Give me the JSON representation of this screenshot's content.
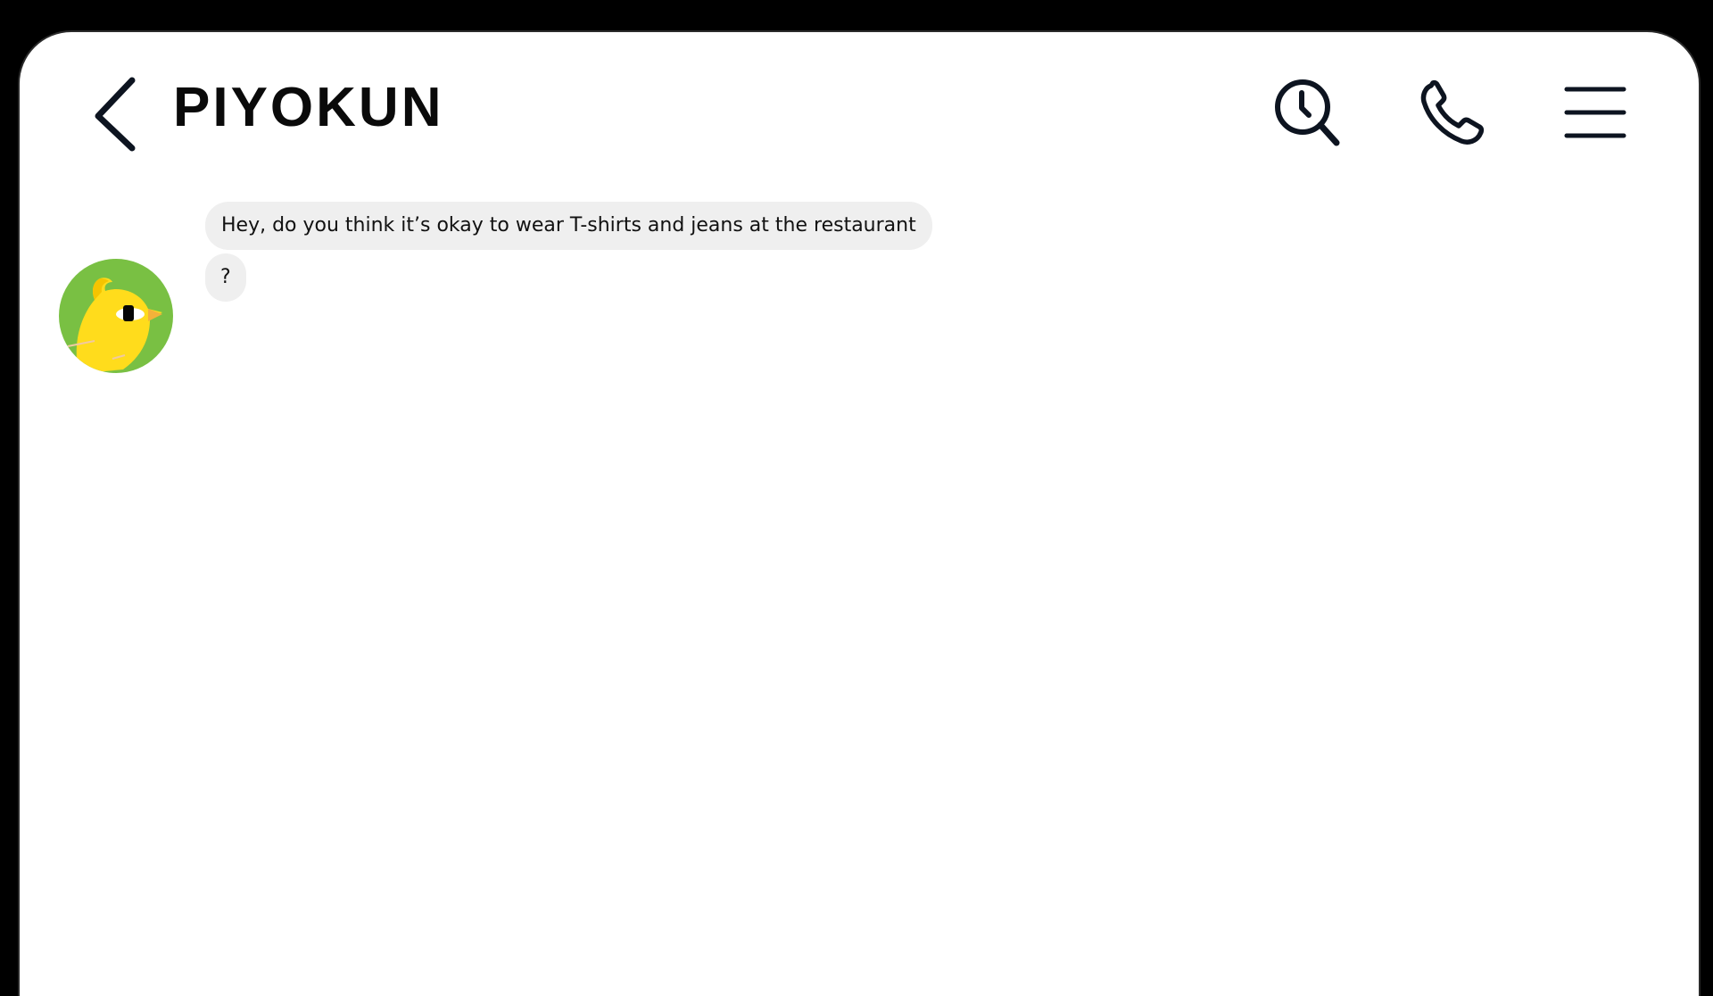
{
  "header": {
    "title": "PIYOKUN",
    "back_icon": "chevron-left-icon",
    "history_icon": "clock-search-icon",
    "call_icon": "phone-icon",
    "menu_icon": "hamburger-menu-icon"
  },
  "conversation": {
    "contact_avatar": "yellow-chick-avatar",
    "messages": [
      {
        "text": "Hey, do you think it’s okay to wear T-shirts and jeans at the restaurant"
      },
      {
        "text": "?"
      }
    ]
  },
  "colors": {
    "bubble_background": "#efefef",
    "avatar_background": "#79c043",
    "chick_yellow": "#ffdc1c",
    "icon_stroke": "#0d1420"
  }
}
